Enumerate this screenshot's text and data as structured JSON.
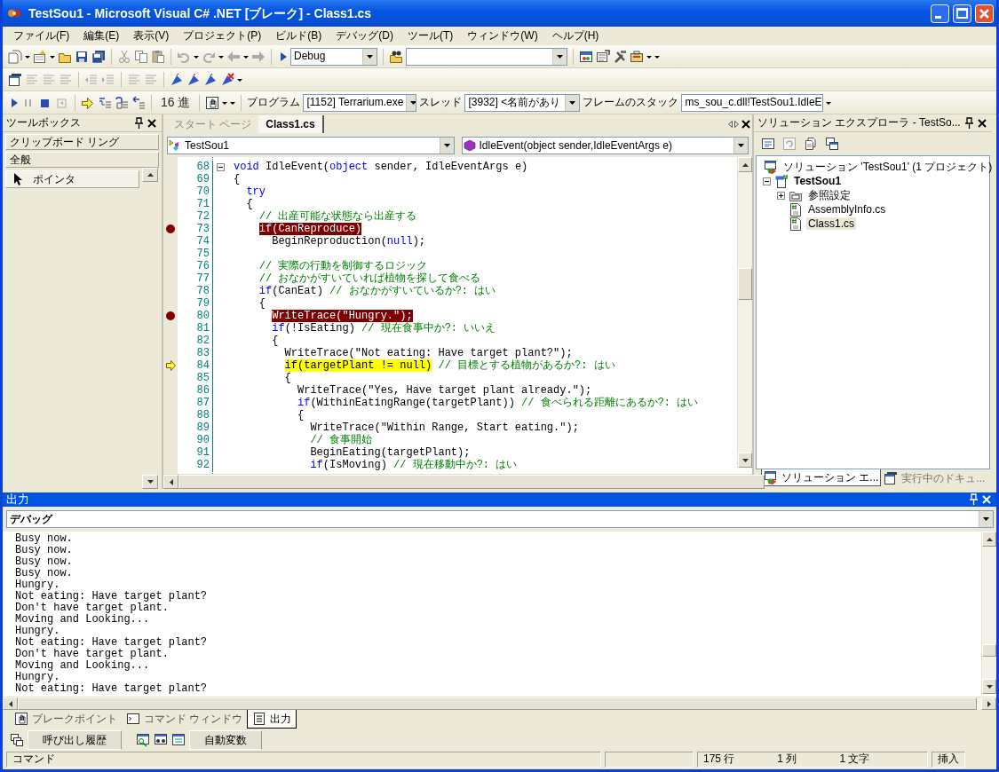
{
  "window": {
    "title": "TestSou1 - Microsoft Visual C# .NET [ブレーク] - Class1.cs"
  },
  "menu": [
    "ファイル(F)",
    "編集(E)",
    "表示(V)",
    "プロジェクト(P)",
    "ビルド(B)",
    "デバッグ(D)",
    "ツール(T)",
    "ウィンドウ(W)",
    "ヘルプ(H)"
  ],
  "standard_toolbar": {
    "configuration": "Debug"
  },
  "debug_toolbar": {
    "hex_button": "16 進",
    "program_label": "プログラム",
    "program": "[1152] Terrarium.exe",
    "thread_label": "スレッド",
    "thread": "[3932] <名前があり",
    "stack_label": "フレームのスタック",
    "stack": "ms_sou_c.dll!TestSou1.IdleE"
  },
  "toolbox": {
    "title": "ツールボックス",
    "sections": [
      "クリップボード リング",
      "全般"
    ],
    "items": [
      {
        "label": "ポインタ",
        "selected": true
      }
    ]
  },
  "editor": {
    "tabs": [
      {
        "label": "スタート ページ",
        "selected": false
      },
      {
        "label": "Class1.cs",
        "selected": true
      }
    ],
    "type_combo": "TestSou1",
    "member_combo": "IdleEvent(object sender,IdleEventArgs e)",
    "lines": [
      {
        "number": "68",
        "kind": "code",
        "collapsible": true,
        "spans": [
          {
            "kind": "keyword",
            "text": "void"
          },
          {
            "kind": "plain",
            "text": " IdleEvent("
          },
          {
            "kind": "keyword",
            "text": "object"
          },
          {
            "kind": "plain",
            "text": " sender, IdleEventArgs e)"
          }
        ]
      },
      {
        "number": "69",
        "kind": "code",
        "spans": [
          {
            "kind": "plain",
            "text": "{"
          }
        ]
      },
      {
        "number": "70",
        "kind": "code",
        "spans": [
          {
            "kind": "keyword",
            "text": "  try"
          }
        ]
      },
      {
        "number": "71",
        "kind": "code",
        "spans": [
          {
            "kind": "plain",
            "text": "  {"
          }
        ]
      },
      {
        "number": "72",
        "kind": "code",
        "spans": [
          {
            "kind": "comment",
            "text": "    // 出産可能な状態なら出産する"
          }
        ]
      },
      {
        "number": "73",
        "kind": "breakpoint",
        "spans": [
          {
            "kind": "breakpoint",
            "text": "    if(CanReproduce)"
          }
        ]
      },
      {
        "number": "74",
        "kind": "code",
        "spans": [
          {
            "kind": "plain",
            "text": "      BeginReproduction("
          },
          {
            "kind": "keyword",
            "text": "null"
          },
          {
            "kind": "plain",
            "text": ");"
          }
        ]
      },
      {
        "number": "75",
        "kind": "code"
      },
      {
        "number": "76",
        "kind": "code",
        "spans": [
          {
            "kind": "comment",
            "text": "    // 実際の行動を制御するロジック"
          }
        ]
      },
      {
        "number": "77",
        "kind": "code",
        "spans": [
          {
            "kind": "comment",
            "text": "    // おなかがすいていれば植物を探して食べる"
          }
        ]
      },
      {
        "number": "78",
        "kind": "code",
        "spans": [
          {
            "kind": "keyword",
            "text": "    if"
          },
          {
            "kind": "plain",
            "text": "(CanEat) "
          },
          {
            "kind": "comment",
            "text": "// おなかがすいているか?: はい"
          }
        ]
      },
      {
        "number": "79",
        "kind": "code",
        "spans": [
          {
            "kind": "plain",
            "text": "    {"
          }
        ]
      },
      {
        "number": "80",
        "kind": "breakpoint",
        "spans": [
          {
            "kind": "breakpoint",
            "text": "      WriteTrace(\"Hungry.\");"
          }
        ]
      },
      {
        "number": "81",
        "kind": "code",
        "spans": [
          {
            "kind": "keyword",
            "text": "      if"
          },
          {
            "kind": "plain",
            "text": "(!IsEating) "
          },
          {
            "kind": "comment",
            "text": "// 現在食事中か?: いいえ"
          }
        ]
      },
      {
        "number": "82",
        "kind": "code",
        "spans": [
          {
            "kind": "plain",
            "text": "      {"
          }
        ]
      },
      {
        "number": "83",
        "kind": "code",
        "spans": [
          {
            "kind": "plain",
            "text": "        WriteTrace(\"Not eating: Have target plant?\");"
          }
        ]
      },
      {
        "number": "84",
        "kind": "current",
        "spans": [
          {
            "kind": "current",
            "text": "        if(targetPlant != null)"
          },
          {
            "kind": "comment",
            "text": " // 目標とする植物があるか?: はい"
          }
        ]
      },
      {
        "number": "85",
        "kind": "code",
        "spans": [
          {
            "kind": "plain",
            "text": "        {"
          }
        ]
      },
      {
        "number": "86",
        "kind": "code",
        "spans": [
          {
            "kind": "plain",
            "text": "          WriteTrace(\"Yes, Have target plant already.\");"
          }
        ]
      },
      {
        "number": "87",
        "kind": "code",
        "spans": [
          {
            "kind": "keyword",
            "text": "          if"
          },
          {
            "kind": "plain",
            "text": "(WithinEatingRange(targetPlant)) "
          },
          {
            "kind": "comment",
            "text": "// 食べられる距離にあるか?: はい"
          }
        ]
      },
      {
        "number": "88",
        "kind": "code",
        "spans": [
          {
            "kind": "plain",
            "text": "          {"
          }
        ]
      },
      {
        "number": "89",
        "kind": "code",
        "spans": [
          {
            "kind": "plain",
            "text": "            WriteTrace(\"Within Range, Start eating.\");"
          }
        ]
      },
      {
        "number": "90",
        "kind": "code",
        "spans": [
          {
            "kind": "comment",
            "text": "            // 食事開始"
          }
        ]
      },
      {
        "number": "91",
        "kind": "code",
        "spans": [
          {
            "kind": "plain",
            "text": "            BeginEating(targetPlant);"
          }
        ]
      },
      {
        "number": "92",
        "kind": "code",
        "spans": [
          {
            "kind": "keyword",
            "text": "            if"
          },
          {
            "kind": "plain",
            "text": "(IsMoving) "
          },
          {
            "kind": "comment",
            "text": "// 現在移動中か?: はい"
          }
        ]
      }
    ]
  },
  "solution_explorer": {
    "title": "ソリューション エクスプローラ - TestSo...",
    "tree": [
      {
        "label": "ソリューション 'TestSou1' (1 プロジェクト)",
        "kind": "solution",
        "selected": false,
        "children": [
          {
            "label": "TestSou1",
            "kind": "project",
            "expanded": true,
            "selected": false,
            "children": [
              {
                "label": "参照設定",
                "kind": "references",
                "expanded": false,
                "selected": false
              },
              {
                "label": "AssemblyInfo.cs",
                "kind": "file",
                "selected": false
              },
              {
                "label": "Class1.cs",
                "kind": "file",
                "selected": true
              }
            ]
          }
        ]
      }
    ],
    "tabs": [
      {
        "label": "ソリューション エ...",
        "selected": true
      },
      {
        "label": "実行中のドキュ...",
        "selected": false
      }
    ]
  },
  "output": {
    "title": "出力",
    "source": "デバッグ",
    "lines": [
      "Busy now.",
      "Busy now.",
      "Busy now.",
      "Busy now.",
      "Hungry.",
      "Not eating: Have target plant?",
      "Don't have target plant.",
      "Moving and Looking...",
      "Hungry.",
      "Not eating: Have target plant?",
      "Don't have target plant.",
      "Moving and Looking...",
      "Hungry.",
      "Not eating: Have target plant?"
    ]
  },
  "bottom_tabs": [
    {
      "label": "ブレークポイント",
      "selected": false
    },
    {
      "label": "コマンド ウィンドウ",
      "selected": false
    },
    {
      "label": "出力",
      "selected": true
    }
  ],
  "lower_tabs": [
    "呼び出し履歴",
    "自動変数"
  ],
  "status_bar": {
    "message": "コマンド",
    "line": "175 行",
    "column": "1 列",
    "char": "1 文字",
    "mode": "挿入"
  }
}
